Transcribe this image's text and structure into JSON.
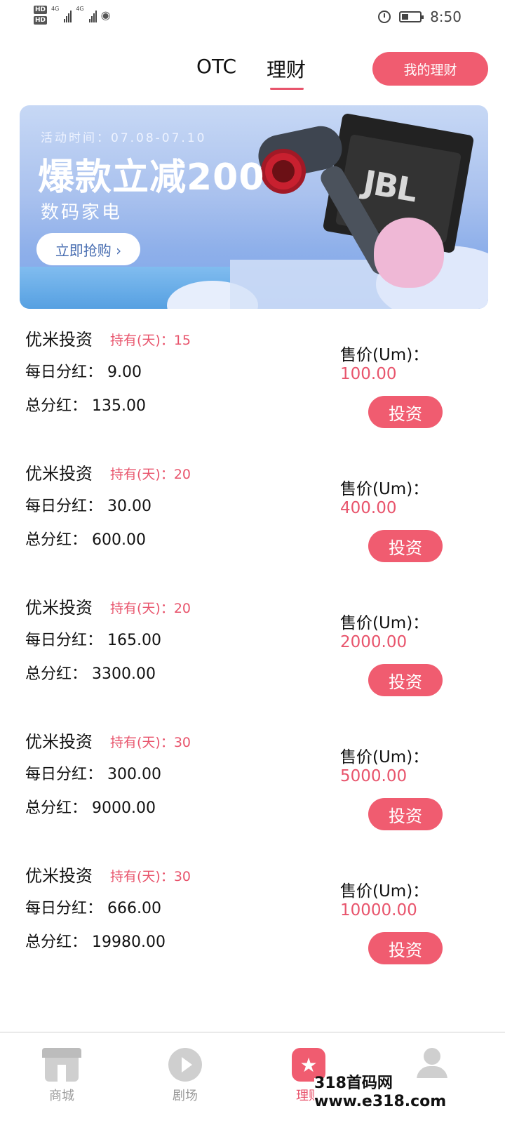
{
  "status_bar": {
    "hd1": "HD",
    "hd2": "HD",
    "network1": "4G",
    "network2": "4G",
    "time": "8:50"
  },
  "header": {
    "tabs": [
      {
        "label": "OTC",
        "active": false
      },
      {
        "label": "理财",
        "active": true
      }
    ],
    "my_licai_button": "我的理财"
  },
  "banner": {
    "event_time": "活动时间：07.08-07.10",
    "title": "爆款立减200",
    "subtitle": "数码家电",
    "button": "立即抢购 ›",
    "brand": "JBL"
  },
  "products": [
    {
      "name": "优米投资",
      "hold": "持有(天)：15",
      "daily": "每日分红： 9.00",
      "total": "总分红： 135.00",
      "price_label": "售价(Um)：",
      "price": "100.00",
      "button": "投资"
    },
    {
      "name": "优米投资",
      "hold": "持有(天)：20",
      "daily": "每日分红： 30.00",
      "total": "总分红： 600.00",
      "price_label": "售价(Um)：",
      "price": "400.00",
      "button": "投资"
    },
    {
      "name": "优米投资",
      "hold": "持有(天)：20",
      "daily": "每日分红： 165.00",
      "total": "总分红： 3300.00",
      "price_label": "售价(Um)：",
      "price": "2000.00",
      "button": "投资"
    },
    {
      "name": "优米投资",
      "hold": "持有(天)：30",
      "daily": "每日分红： 300.00",
      "total": "总分红： 9000.00",
      "price_label": "售价(Um)：",
      "price": "5000.00",
      "button": "投资"
    },
    {
      "name": "优米投资",
      "hold": "持有(天)：30",
      "daily": "每日分红： 666.00",
      "total": "总分红： 19980.00",
      "price_label": "售价(Um)：",
      "price": "10000.00",
      "button": "投资"
    }
  ],
  "bottom_nav": [
    {
      "label": "商城",
      "icon": "shop-icon",
      "active": false
    },
    {
      "label": "剧场",
      "icon": "play-icon",
      "active": false
    },
    {
      "label": "理财",
      "icon": "star-icon",
      "active": true
    },
    {
      "label": "我的",
      "icon": "user-icon",
      "active": false
    }
  ],
  "watermark": "318首码网 www.e318.com",
  "colors": {
    "accent": "#f05c70",
    "accent_text": "#e8546c",
    "nav_inactive": "#9a9a9a"
  }
}
